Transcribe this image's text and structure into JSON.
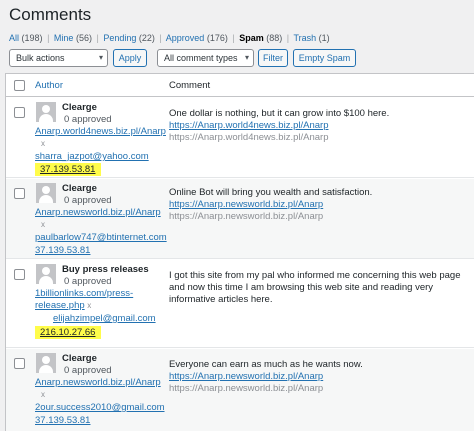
{
  "page_title": "Comments",
  "filters": [
    {
      "label": "All",
      "count": "(198)",
      "current": false
    },
    {
      "label": "Mine",
      "count": "(56)",
      "current": false
    },
    {
      "label": "Pending",
      "count": "(22)",
      "current": false
    },
    {
      "label": "Approved",
      "count": "(176)",
      "current": false
    },
    {
      "label": "Spam",
      "count": "(88)",
      "current": true
    },
    {
      "label": "Trash",
      "count": "(1)",
      "current": false
    }
  ],
  "toolbar": {
    "bulk_actions": "Bulk actions",
    "apply": "Apply",
    "comment_type": "All comment types",
    "filter": "Filter",
    "empty_spam": "Empty Spam"
  },
  "table": {
    "col_author": "Author",
    "col_comment": "Comment"
  },
  "rows": [
    {
      "name": "Clearge",
      "approved": "0 approved",
      "url": "Anarp.world4news.biz.pl/Anarp",
      "x": "x",
      "email": "sharra_jazpot@yahoo.com",
      "ip": "37.139.53.81",
      "ip_highlight": true,
      "comment_lines": [
        "One dollar is nothing, but it can grow into $100 here."
      ],
      "link": "https://Anarp.world4news.biz.pl/Anarp",
      "link_grey": "https://Anarp.world4news.biz.pl/Anarp"
    },
    {
      "name": "Clearge",
      "approved": "0 approved",
      "url": "Anarp.newsworld.biz.pl/Anarp",
      "x": "x",
      "email": "paulbarlow747@btinternet.com",
      "ip": "37.139.53.81",
      "ip_highlight": false,
      "comment_lines": [
        "Online Bot will bring you wealth and satisfaction."
      ],
      "link": "https://Anarp.newsworld.biz.pl/Anarp",
      "link_grey": "https://Anarp.newsworld.biz.pl/Anarp"
    },
    {
      "name": "Buy press releases",
      "approved": "0 approved",
      "url": "1billionlinks.com/press-release.php",
      "x": "x",
      "email": "elijahzimpel@gmail.com",
      "ip": "216.10.27.66",
      "ip_highlight": true,
      "comment_lines": [
        "I got this site from my pal who informed me concerning this web page",
        "and now this time I am browsing this web site and reading very",
        "informative articles here."
      ],
      "link": "",
      "link_grey": ""
    },
    {
      "name": "Clearge",
      "approved": "0 approved",
      "url": "Anarp.newsworld.biz.pl/Anarp",
      "x": "x",
      "email": "2our.success2010@gmail.com",
      "ip": "37.139.53.81",
      "ip_highlight": false,
      "comment_lines": [
        "Everyone can earn as much as he wants now."
      ],
      "link": "https://Anarp.newsworld.biz.pl/Anarp",
      "link_grey": "https://Anarp.newsworld.biz.pl/Anarp"
    }
  ],
  "colors": {
    "link": "#2271b1",
    "highlight": "#fffc4a",
    "background": "#f0f0f1"
  }
}
